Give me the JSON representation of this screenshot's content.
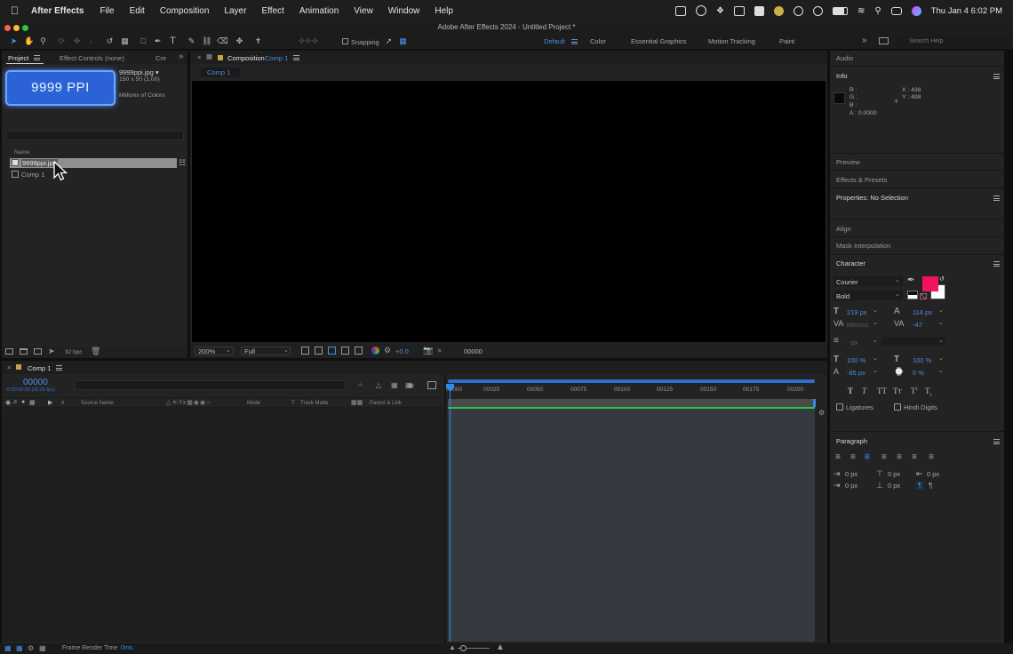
{
  "menubar": {
    "app_name": "After Effects",
    "items": [
      "File",
      "Edit",
      "Composition",
      "Layer",
      "Effect",
      "Animation",
      "View",
      "Window",
      "Help"
    ],
    "clock": "Thu Jan 4  6:02 PM"
  },
  "window": {
    "title": "Adobe After Effects 2024 - Untitled Project *"
  },
  "toolbar": {
    "snapping_label": "Snapping",
    "workspaces": [
      "Default",
      "Color",
      "Essential Graphics",
      "Motion Tracking",
      "Paint"
    ],
    "active_workspace": "Default",
    "search_placeholder": "Search Help"
  },
  "project": {
    "tab_label": "Project",
    "effect_controls_tab": "Effect Controls (none)",
    "cre_tab": "Cre",
    "thumb_text": "9999 PPI",
    "file_name": "9999ppi.jpg ▾",
    "file_dims": "150 x 50 (1.00)",
    "file_colors": "Millions of Colors",
    "name_header": "Name",
    "items": [
      {
        "name": "9999ppi.jpg",
        "selected": true
      },
      {
        "name": "Comp 1",
        "selected": false
      }
    ],
    "bpc": "32 bpc"
  },
  "composition": {
    "tab_prefix": "Composition",
    "tab_comp": "Comp 1",
    "sub_tab": "Comp 1",
    "zoom": "200%",
    "resolution": "Full",
    "exposure": "+0.0",
    "timecode": "00000"
  },
  "timeline": {
    "tab_label": "Comp 1",
    "timecode": "00000",
    "timecode_sub": "0:00:00:00 (30.00 fps)",
    "columns": {
      "source_name": "Source Name",
      "mode": "Mode",
      "t": "T",
      "track_matte": "Track Matte",
      "parent": "Parent & Link",
      "num": "#"
    },
    "ruler_ticks": [
      "00000",
      "00025",
      "00050",
      "00075",
      "00100",
      "00125",
      "00150",
      "00175",
      "00200"
    ],
    "status_label": "Frame Render Time",
    "status_value": "0ms"
  },
  "right": {
    "audio": "Audio",
    "info": {
      "title": "Info",
      "r": "R :",
      "g": "G :",
      "b": "B :",
      "a": "A :  0.0000",
      "x": "X : 438",
      "y": "Y : 498"
    },
    "preview": "Preview",
    "effects_presets": "Effects & Presets",
    "properties": "Properties: No Selection",
    "align": "Align",
    "mask_interpolation": "Mask Interpolation",
    "character": {
      "title": "Character",
      "font": "Courier",
      "style": "Bold",
      "fill_color": "#f0145a",
      "font_size": "219 px",
      "leading": "114 px",
      "kerning": "Metrics",
      "tracking": "-47",
      "stroke_width": "- px",
      "vert_scale": "100 %",
      "horiz_scale": "100 %",
      "baseline": "-65 px",
      "tsume": "0 %",
      "ligatures": "Ligatures",
      "hindi_digits": "Hindi Digits"
    },
    "paragraph": {
      "title": "Paragraph",
      "indent_left": "0 px",
      "indent_first": "0 px",
      "indent_right": "0 px",
      "space_before": "0 px",
      "space_after": "0 px",
      "space_extra": "0 px"
    }
  },
  "colors": {
    "accent": "#2d8cf0",
    "green_bar": "#2fbf4a",
    "thumb_blue": "#2b63d6"
  }
}
